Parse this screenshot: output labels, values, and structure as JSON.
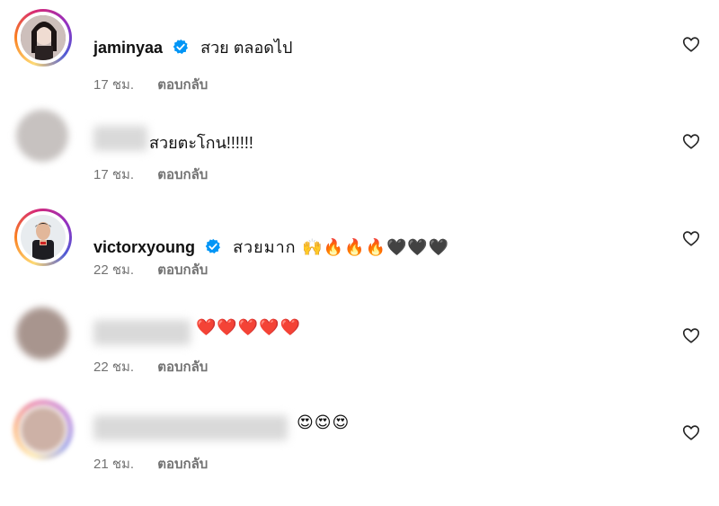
{
  "comments": [
    {
      "username": "jaminyaa",
      "verified": true,
      "text": "สวย ตลอดไป",
      "time": "17 ชม.",
      "reply": "ตอบกลับ",
      "avatar_color": "#d9c9c9"
    },
    {
      "username": "",
      "verified": false,
      "text": "สวยตะโกน!!!!!!",
      "time": "17 ชม.",
      "reply": "ตอบกลับ",
      "avatar_color": "#c9c9c9"
    },
    {
      "username": "victorxyoung",
      "verified": true,
      "text": "สวยมาก 🙌🔥🔥🔥🖤🖤🖤",
      "time": "22 ชม.",
      "reply": "ตอบกลับ",
      "avatar_color": "#cfd6de"
    },
    {
      "username": "",
      "verified": false,
      "text": "❤️❤️❤️❤️❤️",
      "time": "22 ชม.",
      "reply": "ตอบกลับ",
      "avatar_color": "#b7a9a4"
    },
    {
      "username": "",
      "verified": false,
      "text": "😍😍😍",
      "time": "21 ชม.",
      "reply": "ตอบกลับ",
      "avatar_color": "#d4b9c2"
    }
  ],
  "colors": {
    "verified_blue": "#0095f6",
    "meta_gray": "#737373",
    "heart_red": "#e0182d"
  },
  "icons": {
    "like": "heart-outline-icon",
    "verified": "verified-badge-icon"
  }
}
